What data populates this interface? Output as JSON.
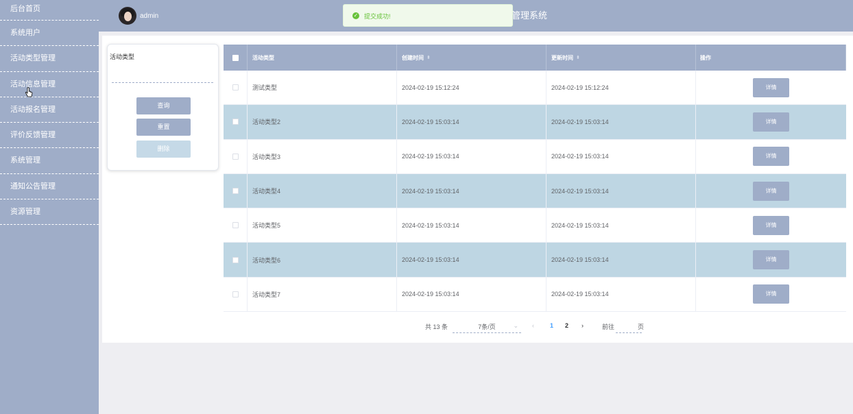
{
  "sidebar": {
    "items": [
      {
        "label": "后台首页"
      },
      {
        "label": "系统用户"
      },
      {
        "label": "活动类型管理"
      },
      {
        "label": "活动信息管理"
      },
      {
        "label": "活动报名管理"
      },
      {
        "label": "评价反馈管理"
      },
      {
        "label": "系统管理"
      },
      {
        "label": "通知公告管理"
      },
      {
        "label": "资源管理"
      }
    ]
  },
  "header": {
    "username": "admin",
    "title_visible": "管理系统"
  },
  "toast": {
    "icon": "check-circle-icon",
    "message": "提交成功!",
    "color": "#67c23a"
  },
  "search": {
    "label": "活动类型",
    "input_value": "",
    "query_label": "查询",
    "reset_label": "重置",
    "delete_label": "删除"
  },
  "table": {
    "headers": {
      "type": "活动类型",
      "created": "创建时间",
      "updated": "更新时间",
      "ops": "操作"
    },
    "rows": [
      {
        "type": "测试类型",
        "created": "2024-02-19 15:12:24",
        "updated": "2024-02-19 15:12:24",
        "action": "详情"
      },
      {
        "type": "活动类型2",
        "created": "2024-02-19 15:03:14",
        "updated": "2024-02-19 15:03:14",
        "action": "详情"
      },
      {
        "type": "活动类型3",
        "created": "2024-02-19 15:03:14",
        "updated": "2024-02-19 15:03:14",
        "action": "详情"
      },
      {
        "type": "活动类型4",
        "created": "2024-02-19 15:03:14",
        "updated": "2024-02-19 15:03:14",
        "action": "详情"
      },
      {
        "type": "活动类型5",
        "created": "2024-02-19 15:03:14",
        "updated": "2024-02-19 15:03:14",
        "action": "详情"
      },
      {
        "type": "活动类型6",
        "created": "2024-02-19 15:03:14",
        "updated": "2024-02-19 15:03:14",
        "action": "详情"
      },
      {
        "type": "活动类型7",
        "created": "2024-02-19 15:03:14",
        "updated": "2024-02-19 15:03:14",
        "action": "详情"
      }
    ]
  },
  "pagination": {
    "total": "共 13 条",
    "page_size": "7条/页",
    "prev": "‹",
    "pages": [
      "1",
      "2"
    ],
    "current": "1",
    "next": "›",
    "goto": "前往",
    "goto_value": "",
    "page_suffix": "页"
  },
  "colors": {
    "sidebar_bg": "#9fadc8",
    "stripe": "#bed6e3",
    "accent": "#409eff"
  }
}
